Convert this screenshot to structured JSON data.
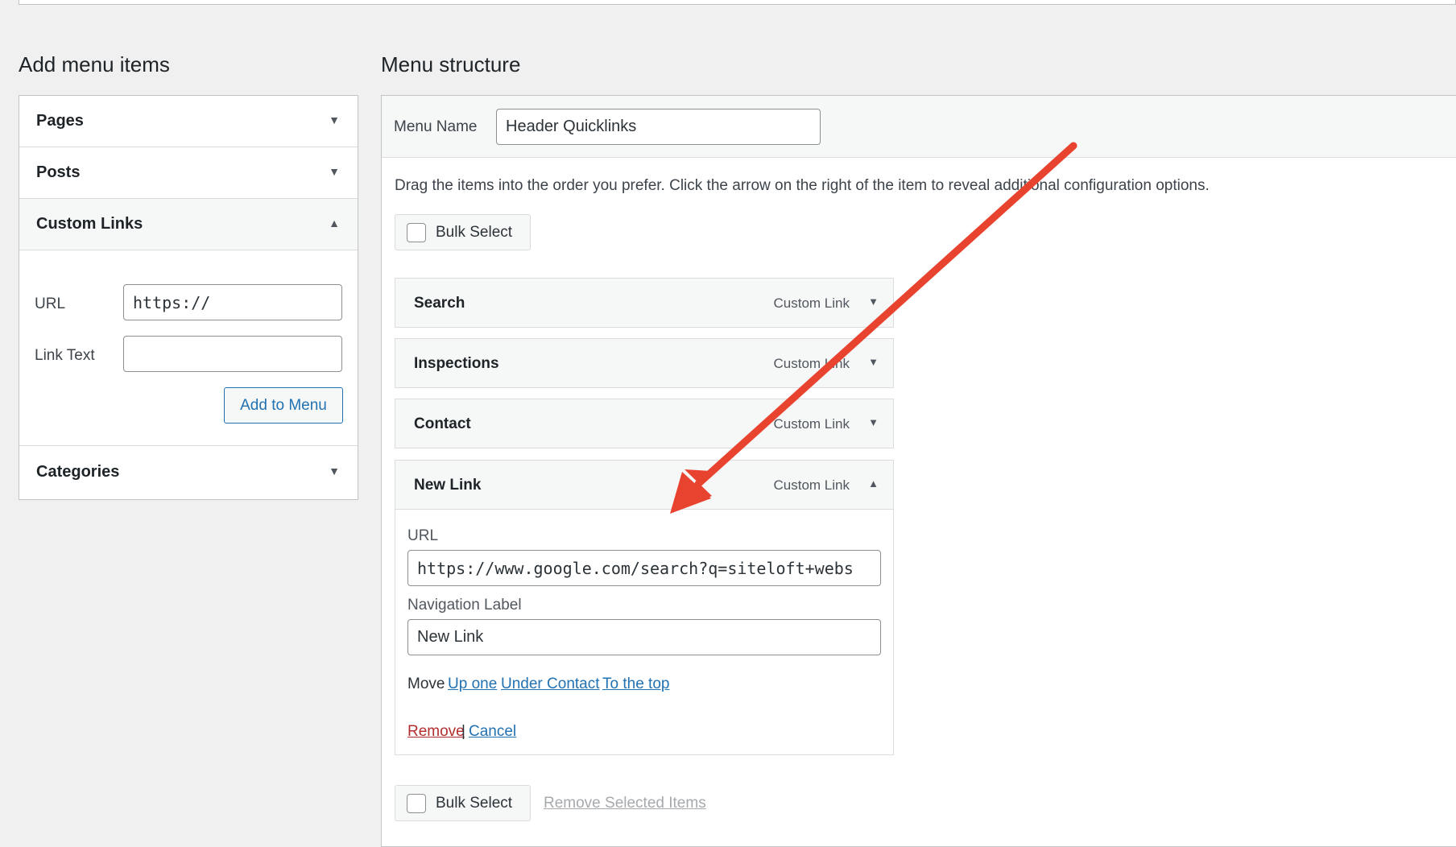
{
  "left_heading": "Add menu items",
  "right_heading": "Menu structure",
  "accordion": {
    "pages": "Pages",
    "posts": "Posts",
    "custom_links": "Custom Links",
    "categories": "Categories",
    "url_label": "URL",
    "url_value": "https://",
    "link_text_label": "Link Text",
    "link_text_value": "",
    "add_button": "Add to Menu"
  },
  "menu": {
    "name_label": "Menu Name",
    "name_value": "Header Quicklinks",
    "instructions": "Drag the items into the order you prefer. Click the arrow on the right of the item to reveal additional configuration options.",
    "bulk_select": "Bulk Select",
    "remove_selected": "Remove Selected Items",
    "items": [
      {
        "title": "Search",
        "type": "Custom Link"
      },
      {
        "title": "Inspections",
        "type": "Custom Link"
      },
      {
        "title": "Contact",
        "type": "Custom Link"
      },
      {
        "title": "New Link",
        "type": "Custom Link"
      }
    ],
    "edit": {
      "url_label": "URL",
      "url_value": "https://www.google.com/search?q=siteloft+webs",
      "nav_label": "Navigation Label",
      "nav_value": "New Link",
      "move_label": "Move",
      "move_up": "Up one",
      "move_under": "Under Contact",
      "move_top": "To the top",
      "remove": "Remove",
      "separator": "|",
      "cancel": "Cancel"
    }
  },
  "colors": {
    "link": "#2271b1",
    "remove": "#b32d2e",
    "annotation_arrow": "#e8432f"
  },
  "icons": {
    "collapsed": "▼",
    "expanded": "▲"
  }
}
